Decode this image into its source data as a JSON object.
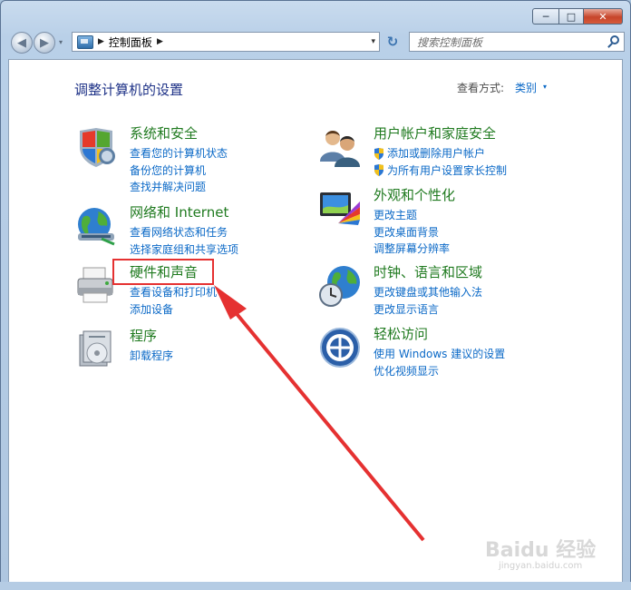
{
  "window": {
    "min_label": "─",
    "max_label": "□",
    "close_label": "✕"
  },
  "nav": {
    "back_icon": "◀",
    "forward_icon": "▶",
    "history_dropdown": "▾",
    "crumb_separator": "▶",
    "crumb": "控制面板",
    "crumb_trailing_separator": "▶",
    "address_dropdown": "▾",
    "refresh_icon": "↻",
    "search_placeholder": "搜索控制面板"
  },
  "header": {
    "title": "调整计算机的设置",
    "view_by_label": "查看方式:",
    "view_mode": "类别",
    "view_mode_dropdown": "▾"
  },
  "categories_left": [
    {
      "title": "系统和安全",
      "links": [
        "查看您的计算机状态",
        "备份您的计算机",
        "查找并解决问题"
      ]
    },
    {
      "title": "网络和 Internet",
      "links": [
        "查看网络状态和任务",
        "选择家庭组和共享选项"
      ]
    },
    {
      "title": "硬件和声音",
      "links": [
        "查看设备和打印机",
        "添加设备"
      ]
    },
    {
      "title": "程序",
      "links": [
        "卸载程序"
      ]
    }
  ],
  "categories_right": [
    {
      "title": "用户帐户和家庭安全",
      "links": [
        "添加或删除用户帐户",
        "为所有用户设置家长控制"
      ]
    },
    {
      "title": "外观和个性化",
      "links": [
        "更改主题",
        "更改桌面背景",
        "调整屏幕分辨率"
      ]
    },
    {
      "title": "时钟、语言和区域",
      "links": [
        "更改键盘或其他输入法",
        "更改显示语言"
      ]
    },
    {
      "title": "轻松访问",
      "links": [
        "使用 Windows 建议的设置",
        "优化视频显示"
      ]
    }
  ],
  "watermark": {
    "main": "Baidu 经验",
    "sub": "jingyan.baidu.com"
  },
  "colors": {
    "title_green": "#1f7a1f",
    "link_blue": "#0b69c7",
    "heading_blue": "#1e3287",
    "annotation_red": "#e53131"
  }
}
